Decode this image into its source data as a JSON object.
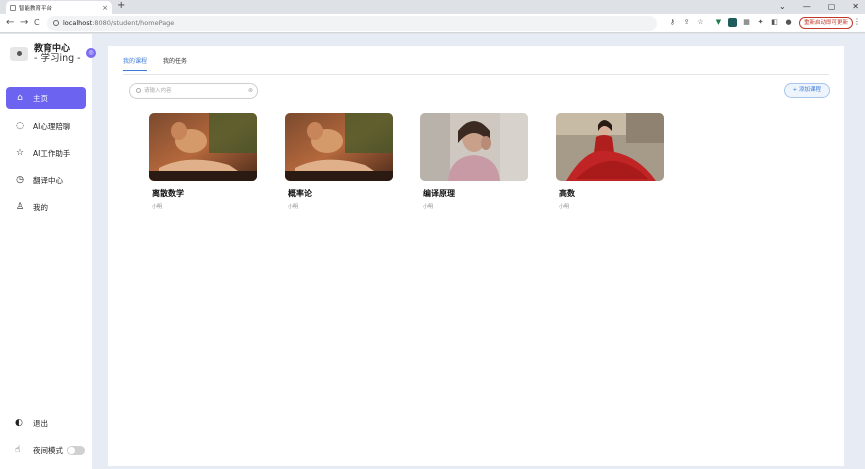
{
  "browser": {
    "tab_title": "智能教育平台",
    "tab_close": "×",
    "new_tab": "+",
    "window_controls": [
      "⌄",
      "—",
      "▢",
      "✕"
    ],
    "nav": {
      "back": "←",
      "forward": "→",
      "reload": "C"
    },
    "url_host": "localhost",
    "url_path": ":8080/student/homePage",
    "update_button": "重新启动即可更新",
    "menu": "⋮"
  },
  "sidebar": {
    "brand_title": "教育中心",
    "brand_subtitle": "- 学习ing -",
    "items": [
      {
        "label": "主页",
        "icon": "home-icon",
        "active": true
      },
      {
        "label": "AI心理陪聊",
        "icon": "chat-icon",
        "active": false
      },
      {
        "label": "AI工作助手",
        "icon": "star-icon",
        "active": false
      },
      {
        "label": "翻译中心",
        "icon": "clock-icon",
        "active": false
      },
      {
        "label": "我的",
        "icon": "user-icon",
        "active": false
      }
    ],
    "logout_label": "退出",
    "night_mode_label": "夜间模式"
  },
  "main": {
    "tabs": [
      "我的课程",
      "我的任务"
    ],
    "search_placeholder": "请输入内容",
    "add_course_label": "+ 添加课程",
    "courses": [
      {
        "name": "离散数学",
        "teacher": "小明"
      },
      {
        "name": "概率论",
        "teacher": "小明"
      },
      {
        "name": "编译原理",
        "teacher": "小明"
      },
      {
        "name": "高数",
        "teacher": "小明"
      }
    ]
  },
  "colors": {
    "accent": "#6c63f0",
    "tab_active": "#3d7bd9",
    "app_background": "#e7ebf4"
  }
}
